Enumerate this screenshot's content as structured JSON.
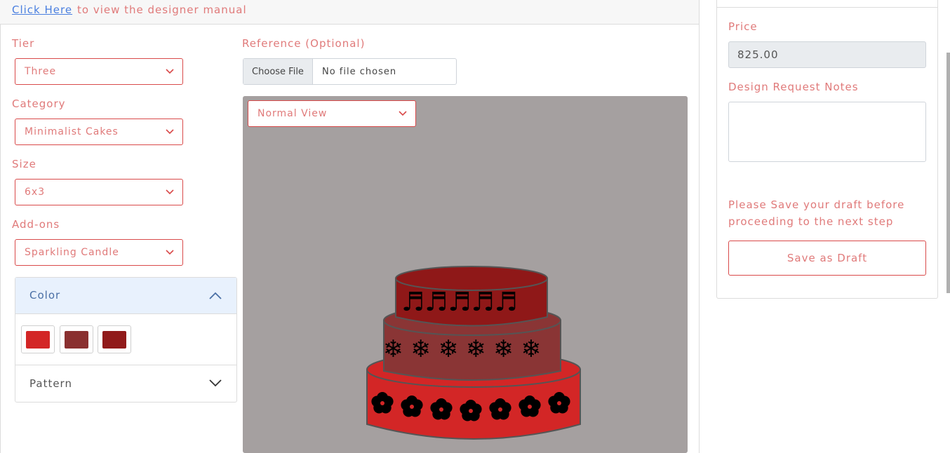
{
  "topbar": {
    "link_text": "Click Here",
    "rest_text": "to view the designer manual"
  },
  "form": {
    "tier": {
      "label": "Tier",
      "value": "Three"
    },
    "category": {
      "label": "Category",
      "value": "Minimalist Cakes"
    },
    "size": {
      "label": "Size",
      "value": "6x3"
    },
    "addons": {
      "label": "Add-ons",
      "value": "Sparkling Candle"
    },
    "reference": {
      "label": "Reference (Optional)",
      "button": "Choose File",
      "status": "No file chosen"
    }
  },
  "canvas": {
    "view_value": "Normal View",
    "background": "#a5a0a0"
  },
  "accordion": {
    "color_title": "Color",
    "pattern_title": "Pattern",
    "swatches": [
      "#d32626",
      "#8a3030",
      "#911a1a"
    ]
  },
  "cake": {
    "tier_colors": {
      "top": "#8f1818",
      "middle": "#8a3535",
      "bottom": "#d32626"
    },
    "patterns": {
      "top": "music-note-icon",
      "middle": "snowflake-icon",
      "bottom": "flower-icon"
    },
    "glyphs": {
      "top": "♬♬♬♬♬",
      "middle": "❄ ❄ ❄ ❄ ❄ ❄"
    }
  },
  "panel": {
    "price_label": "Price",
    "price_value": "825.00",
    "notes_label": "Design Request Notes",
    "hint": "Please Save your draft before proceeding to the next step",
    "save_button": "Save as Draft"
  },
  "colors": {
    "accent": "#e07a7a",
    "border_accent": "#d94a4a",
    "link": "#4a7fe0"
  }
}
